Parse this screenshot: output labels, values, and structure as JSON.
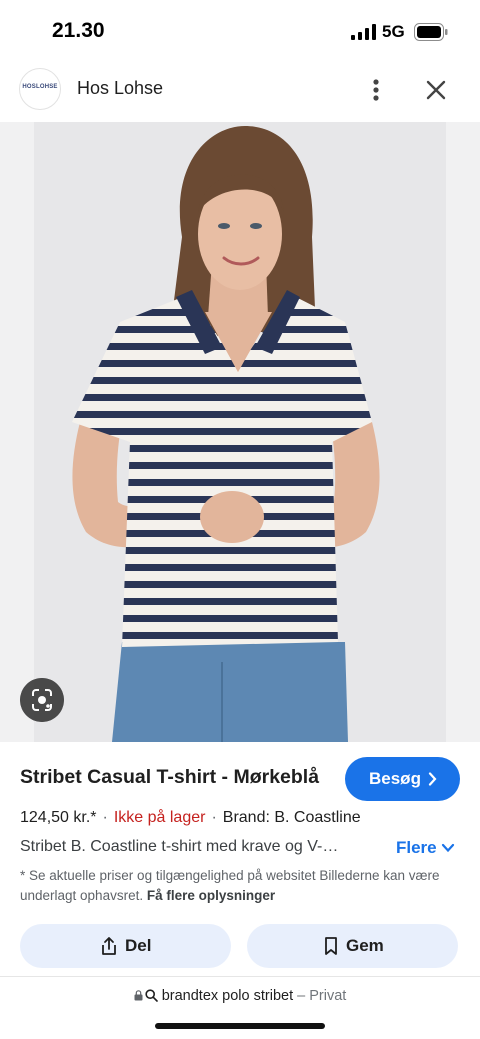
{
  "status_bar": {
    "time": "21.30",
    "network": "5G"
  },
  "header": {
    "site_name": "Hos Lohse",
    "logo_text": "HOSLOHSE"
  },
  "product": {
    "title": "Stribet Casual T-shirt - Mørkeblå",
    "visit_label": "Besøg",
    "price": "124,50 kr.*",
    "stock": "Ikke på lager",
    "brand": "Brand: B. Coastline",
    "description": "Stribet B. Coastline t-shirt med krave og V-…",
    "more_label": "Flere",
    "disclaimer": "* Se aktuelle priser og tilgængelighed på websitet Billederne kan være underlagt ophavsret.",
    "disclaimer_link": "Få flere oplysninger"
  },
  "actions": {
    "share_label": "Del",
    "save_label": "Gem"
  },
  "url_bar": {
    "query": "brandtex polo stribet",
    "suffix": "– Privat"
  },
  "colors": {
    "accent": "#1a73e8",
    "out_of_stock": "#c5221f",
    "action_bg": "#e8effc",
    "shirt_stripe": "#2a3556",
    "jeans": "#5d88b3"
  }
}
